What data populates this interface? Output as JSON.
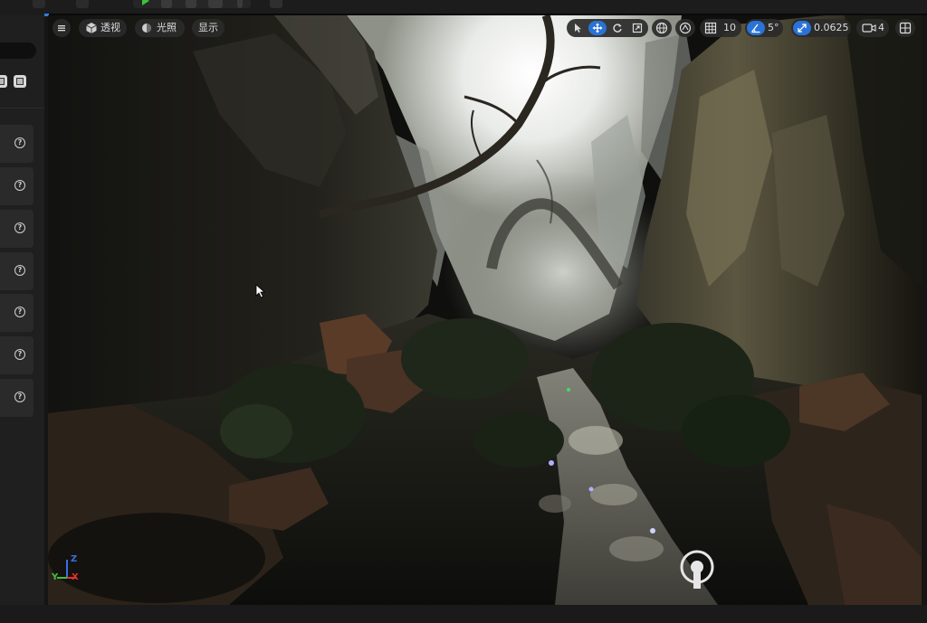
{
  "viewport": {
    "view_mode_label": "透视",
    "lighting_label": "光照",
    "show_label": "显示",
    "grid_snap_value": "10",
    "rotation_snap_value": "5°",
    "scale_snap_value": "0.0625",
    "camera_speed_value": "4",
    "axis_labels": {
      "x": "X",
      "y": "Y",
      "z": "Z"
    }
  },
  "colors": {
    "accent": "#2a72d6",
    "axis_x": "#e03030",
    "axis_y": "#3fbf3f",
    "axis_z": "#3a6fe0",
    "play": "#3fbf3f"
  },
  "icons": {
    "viewport_menu": "hamburger-icon",
    "view_mode": "cube-icon",
    "lighting": "lit-sphere-icon",
    "select": "arrow-cursor-icon",
    "translate": "move-arrows-icon",
    "rotate": "rotate-icon",
    "scale": "scale-icon",
    "world_local": "globe-icon",
    "surface_snap": "surface-snap-icon",
    "grid_snap": "grid-icon",
    "rotation_snap": "angle-icon",
    "scale_snap": "scale-arrow-icon",
    "camera_speed": "camera-icon",
    "layout": "layout-grid-icon",
    "left_panel_items": "help-icon"
  }
}
